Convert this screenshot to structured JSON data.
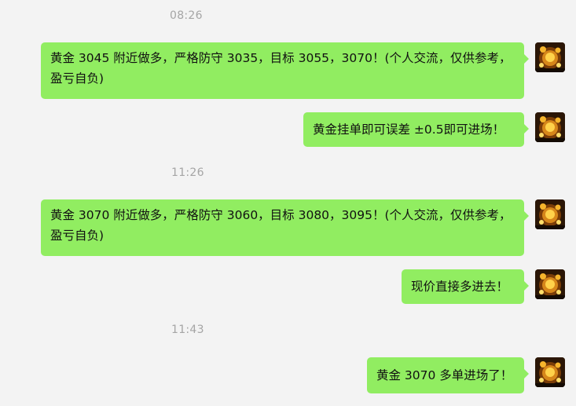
{
  "chat": {
    "messages": [
      {
        "timestamp": "08:26",
        "text": "黄金 3045 附近做多，严格防守 3035，目标 3055，3070！(个人交流，仅供参考，盈亏自负)"
      },
      {
        "text": "黄金挂单即可误差 ±0.5即可进场！"
      },
      {
        "timestamp": "11:26",
        "text": "黄金 3070 附近做多，严格防守 3060，目标 3080，3095！(个人交流，仅供参考，盈亏自负)"
      },
      {
        "text": "现价直接多进去！"
      },
      {
        "timestamp": "11:43",
        "text": "黄金 3070 多单进场了！"
      }
    ]
  },
  "colors": {
    "background": "#f3f3f3",
    "bubble": "#91ed61",
    "timestamp": "#a5a5a5"
  },
  "icons": {
    "avatar": "avatar-image"
  }
}
